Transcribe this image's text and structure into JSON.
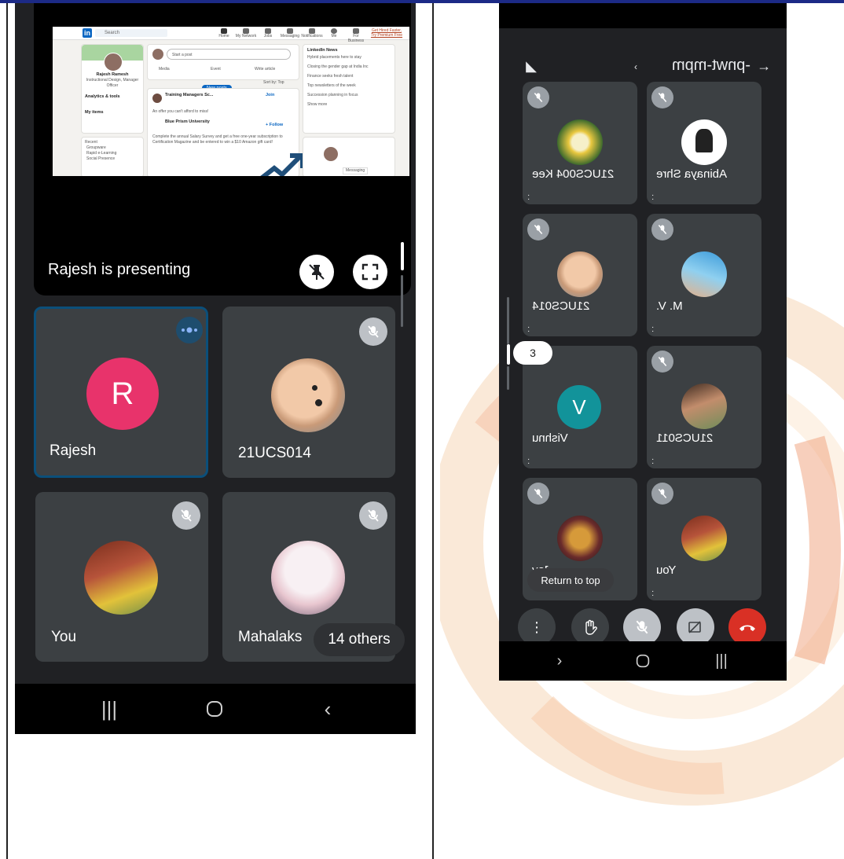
{
  "colors": {
    "accent": "#1a73e8",
    "speaking_border": "#0b4f7a",
    "rajesh_avatar": "#e8336b",
    "vishnu_avatar": "#12939a",
    "end_call": "#d93025"
  },
  "left_screen": {
    "presentation": {
      "label": "Rajesh is presenting",
      "shared_content": {
        "search_placeholder": "Search",
        "nav_items": [
          "Home",
          "My Network",
          "Jobs",
          "Messaging",
          "Notifications",
          "Me",
          "For Business",
          "Get Hired Faster, Try Premium Free"
        ],
        "profile_name": "Rajesh Ramesh",
        "profile_title": "Instructional Design, Manager Officer",
        "analytics": "Analytics & tools",
        "my_items": "My items",
        "recent_label": "Recent",
        "recent_items": [
          "Groupware",
          "Rapid e-Learning",
          "Social Presence"
        ],
        "start_post": "Start a post",
        "post_actions": [
          "Media",
          "Event",
          "Write article"
        ],
        "sort_by": "Sort by: Top",
        "new_posts": "New posts",
        "feed_post_title": "Training Managers Sc...",
        "join": "Join",
        "offer_text": "An offer you can't afford to miss!",
        "company": "Blue Prism University",
        "follow": "+ Follow",
        "survey_text": "Complete the annual Salary Survey and get a free one-year subscription to Certification Magazine and be entered to win a $10 Amazon gift card!",
        "news_title": "LinkedIn News",
        "news_items": [
          "Hybrid placements here to stay",
          "Closing the gender gap at India Inc",
          "Finance seeks fresh talent",
          "Top newsletters of the week",
          "Succession planning in focus"
        ],
        "show_more": "Show more",
        "messaging": "Messaging"
      }
    },
    "tiles": [
      {
        "name": "Rajesh",
        "initial": "R",
        "speaking": true
      },
      {
        "name": "21UCS014",
        "muted": true
      },
      {
        "name": "You",
        "muted": true
      },
      {
        "name": "Mahalaks",
        "muted": true
      }
    ],
    "others_pill": "14 others",
    "icons": {
      "unpin": "unpin-icon",
      "fullscreen": "fullscreen-icon",
      "speaking": "speaking-indicator-icon",
      "mic_off": "mic-off-icon"
    }
  },
  "right_screen": {
    "meeting_code": "-pnwt-mpm",
    "tiles": [
      {
        "name": "Abinaya Shre"
      },
      {
        "name": "21UCS004 Kee"
      },
      {
        "name": "M. V."
      },
      {
        "name": "21UCS014"
      },
      {
        "name": "21UCS011"
      },
      {
        "name": "Vishnu",
        "initial": "V"
      },
      {
        "name": "You"
      },
      {
        "name": "Jay"
      }
    ],
    "return_to_top": "Return to top",
    "badge_count": "3",
    "controls": [
      "more-options-icon",
      "raise-hand-icon",
      "mic-off-icon",
      "camera-off-icon",
      "end-call-icon"
    ]
  }
}
